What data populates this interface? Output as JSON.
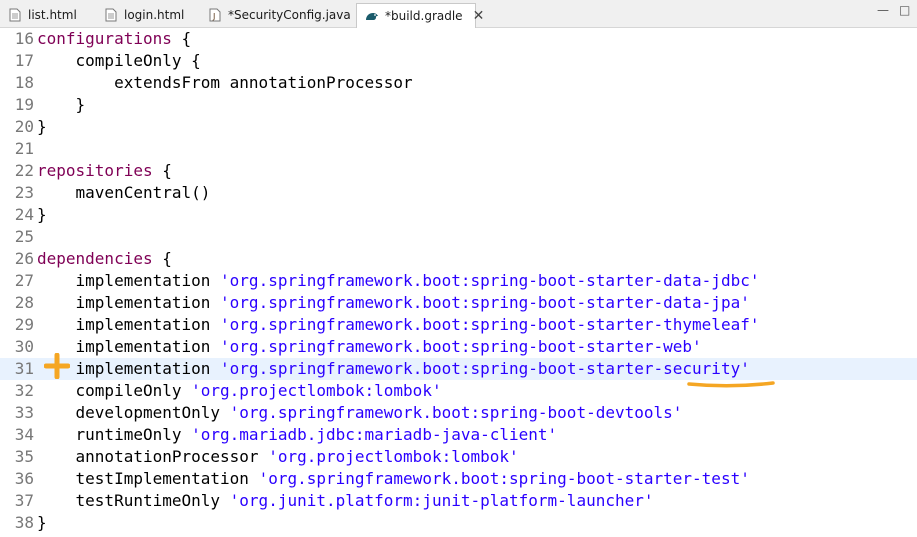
{
  "tabs": [
    {
      "label": "list.html",
      "icon": "file-icon",
      "active": false
    },
    {
      "label": "login.html",
      "icon": "file-icon",
      "active": false
    },
    {
      "label": "*SecurityConfig.java",
      "icon": "java-file-icon",
      "active": false
    },
    {
      "label": "*build.gradle",
      "icon": "gradle-icon",
      "active": true
    }
  ],
  "window_controls": {
    "minimize": "—",
    "maximize": "□"
  },
  "editor": {
    "current_line": "31",
    "lines": [
      {
        "n": "16",
        "kw": "configurations",
        "rest": " {"
      },
      {
        "n": "17",
        "text": "    compileOnly {"
      },
      {
        "n": "18",
        "text": "        extendsFrom annotationProcessor"
      },
      {
        "n": "19",
        "text": "    }"
      },
      {
        "n": "20",
        "text": "}"
      },
      {
        "n": "21",
        "text": ""
      },
      {
        "n": "22",
        "kw": "repositories",
        "rest": " {"
      },
      {
        "n": "23",
        "text": "    mavenCentral()"
      },
      {
        "n": "24",
        "text": "}"
      },
      {
        "n": "25",
        "text": ""
      },
      {
        "n": "26",
        "kw": "dependencies",
        "rest": " {"
      },
      {
        "n": "27",
        "pre": "    implementation ",
        "str": "'org.springframework.boot:spring-boot-starter-data-jdbc'"
      },
      {
        "n": "28",
        "pre": "    implementation ",
        "str": "'org.springframework.boot:spring-boot-starter-data-jpa'"
      },
      {
        "n": "29",
        "pre": "    implementation ",
        "str": "'org.springframework.boot:spring-boot-starter-thymeleaf'"
      },
      {
        "n": "30",
        "pre": "    implementation ",
        "str": "'org.springframework.boot:spring-boot-starter-web'"
      },
      {
        "n": "31",
        "pre": "    implementation ",
        "str": "'org.springframework.boot:spring-boot-starter-security'"
      },
      {
        "n": "32",
        "pre": "    compileOnly ",
        "str": "'org.projectlombok:lombok'"
      },
      {
        "n": "33",
        "pre": "    developmentOnly ",
        "str": "'org.springframework.boot:spring-boot-devtools'"
      },
      {
        "n": "34",
        "pre": "    runtimeOnly ",
        "str": "'org.mariadb.jdbc:mariadb-java-client'"
      },
      {
        "n": "35",
        "pre": "    annotationProcessor ",
        "str": "'org.projectlombok:lombok'"
      },
      {
        "n": "36",
        "pre": "    testImplementation ",
        "str": "'org.springframework.boot:spring-boot-starter-test'"
      },
      {
        "n": "37",
        "pre": "    testRuntimeOnly ",
        "str": "'org.junit.platform:junit-platform-launcher'"
      },
      {
        "n": "38",
        "text": "}"
      }
    ]
  },
  "annotations": {
    "marker_icon": "plus-icon",
    "underline_word": "security",
    "highlight_color": "#f5a623"
  },
  "colors": {
    "keyword": "#7f0055",
    "string": "#2a00ff",
    "line_number": "#787878",
    "current_line_bg": "#e8f2fe"
  }
}
